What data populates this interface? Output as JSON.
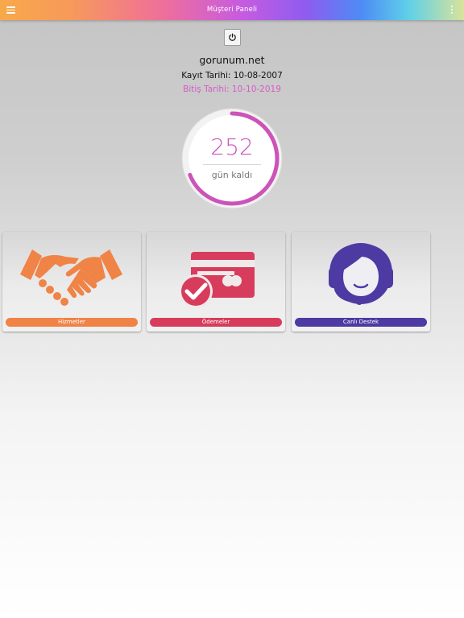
{
  "header": {
    "title": "Müşteri Paneli",
    "menu_icon": "hamburger-menu-icon",
    "more_icon": "more-vertical-icon",
    "gradient": [
      "#f7a94a",
      "#ef6f9a",
      "#c75be0",
      "#4d8cf5",
      "#5fd0e8",
      "#d8e39a"
    ]
  },
  "account": {
    "power_icon": "power-icon",
    "domain": "gorunum.net",
    "registration": "Kayıt Tarihi: 10-08-2007",
    "expiry": "Bitiş Tarihi: 10-10-2019"
  },
  "countdown": {
    "days": "252",
    "label": "gün kaldı",
    "progress": 0.69,
    "color": "#cc53b8"
  },
  "cards": [
    {
      "label": "Hizmetler",
      "icon": "handshake-icon",
      "color": "#f08346"
    },
    {
      "label": "Ödemeler",
      "icon": "credit-card-check-icon",
      "color": "#d83c5c"
    },
    {
      "label": "Canlı Destek",
      "icon": "support-headset-icon",
      "color": "#4d3aa3"
    }
  ]
}
